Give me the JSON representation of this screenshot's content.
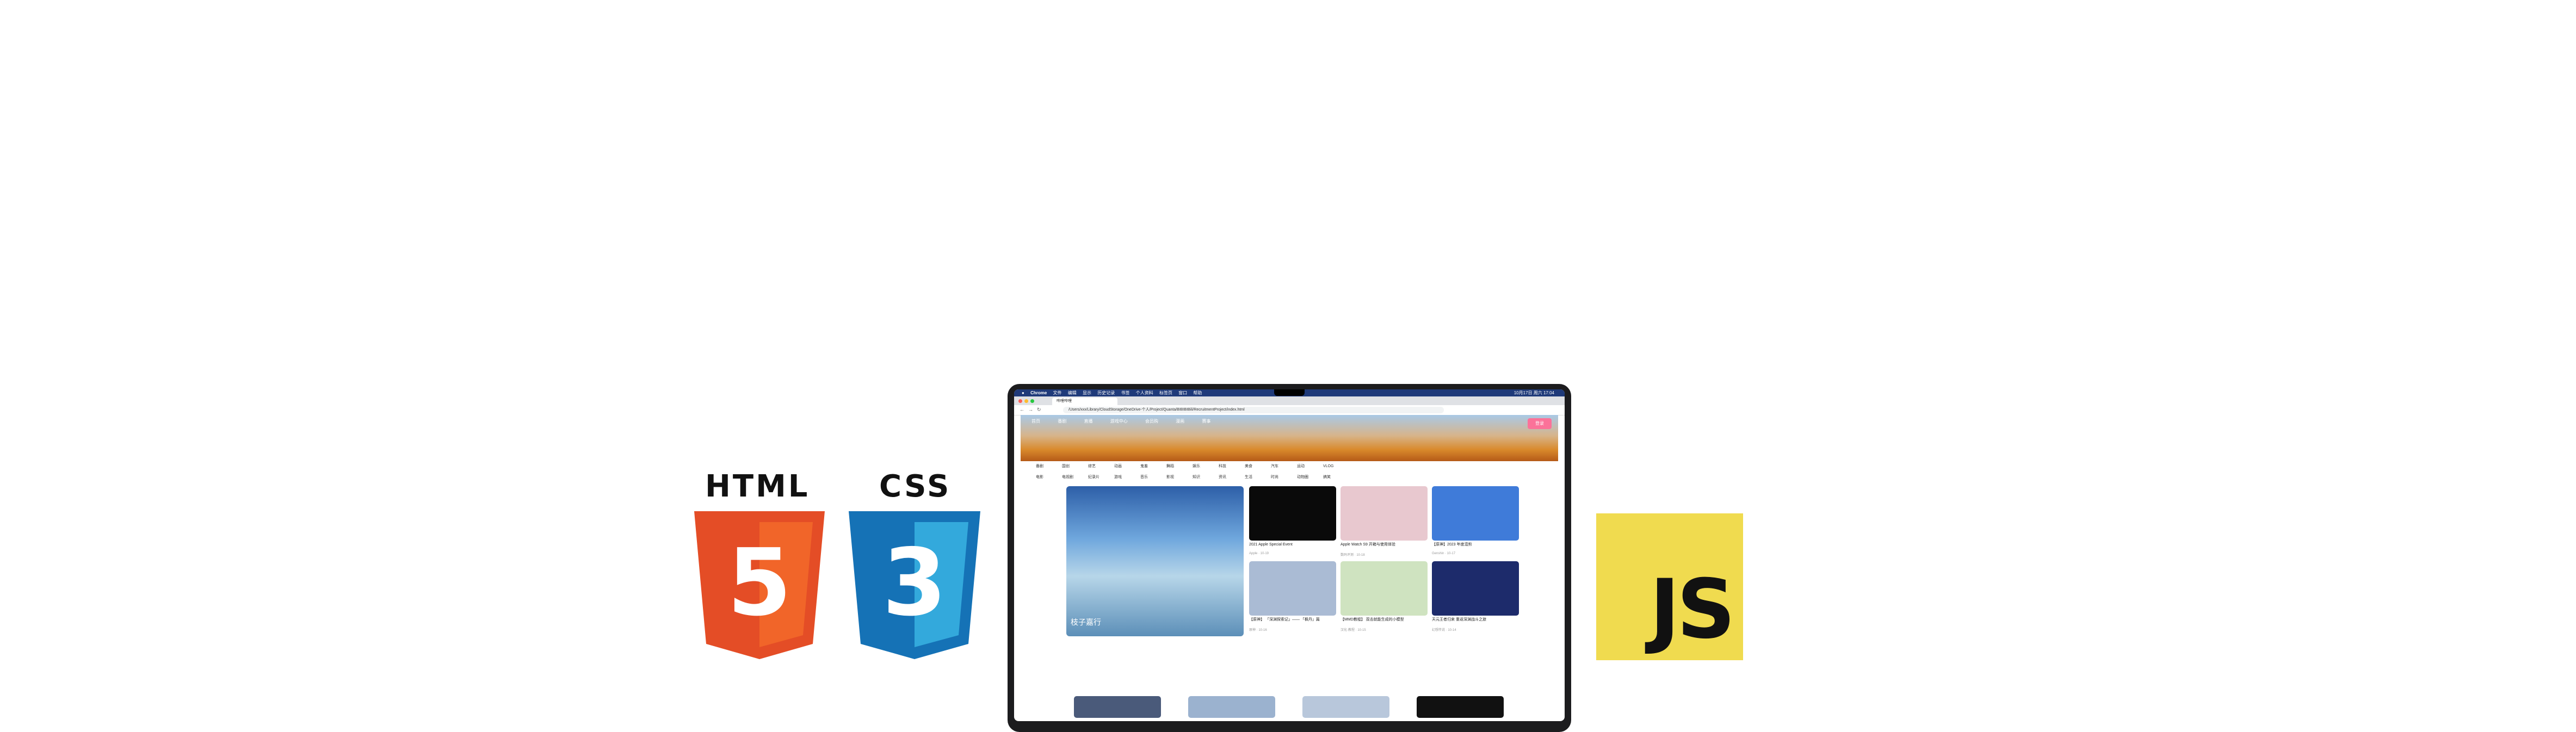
{
  "logos": {
    "html_label": "HTML",
    "html_number": "5",
    "css_label": "CSS",
    "css_number": "3",
    "js_label": "JS",
    "colors": {
      "html_shield": "#e44d26",
      "html_shield_light": "#f16529",
      "css_shield": "#1572b6",
      "css_shield_light": "#33a9dc",
      "js_bg": "#f0db4f"
    }
  },
  "screen": {
    "menubar": {
      "app": "Chrome",
      "items": [
        "文件",
        "编辑",
        "显示",
        "历史记录",
        "书签",
        "个人资料",
        "标签页",
        "窗口",
        "帮助"
      ],
      "clock": "10月17日 周六 17:04"
    },
    "tab_title": "哔哩哔哩",
    "url": "/Users/xxx/Library/CloudStorage/OneDrive-个人/Project/Quanta/BIBIBIBili/RecruitmentProject/index.html",
    "banner_nav": [
      "首页",
      "番剧",
      "直播",
      "游戏中心",
      "会员购",
      "漫画",
      "赛事"
    ],
    "login_label": "登录",
    "categories_row1": [
      "番剧",
      "国创",
      "综艺",
      "动画",
      "鬼畜",
      "舞蹈",
      "娱乐",
      "科技",
      "美食",
      "汽车",
      "运动",
      "VLOG"
    ],
    "categories_row2": [
      "电影",
      "电视剧",
      "纪录片",
      "游戏",
      "音乐",
      "影视",
      "知识",
      "资讯",
      "生活",
      "时尚",
      "动物圈",
      "搞笑"
    ],
    "featured_caption": "枝子嘉行",
    "cards": [
      {
        "title": "2021 Apple Special Event",
        "meta": "Apple · 10-19"
      },
      {
        "title": "Apple Watch S9 开箱与使用体验",
        "meta": "数码评测 · 10-18"
      },
      {
        "title": "【原神】2023 年度混剪",
        "meta": "Genshin · 10-17"
      },
      {
        "title": "【原神】 「深渊探索记」—— 「枫丹」篇",
        "meta": "原神 · 10-16"
      },
      {
        "title": "【MMD教程】 双击就能生成的小模型",
        "meta": "汉化·教程 · 10-15"
      },
      {
        "title": "天元王者归来 重返深渊战斗之旅",
        "meta": "幻想传说 · 10-14"
      }
    ]
  }
}
